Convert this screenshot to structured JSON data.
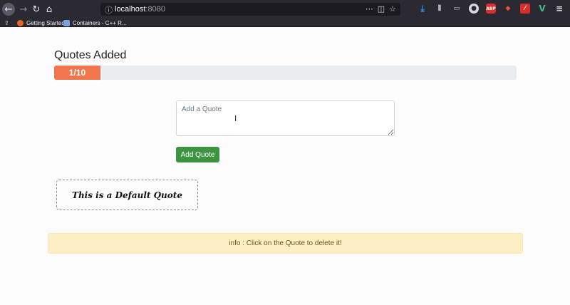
{
  "browser": {
    "url_host": "localhost",
    "url_port": ":8080",
    "bookmarks": [
      {
        "label": "Getting Started"
      },
      {
        "label": "Containers - C++ R..."
      }
    ],
    "extension_icons": [
      "download-icon",
      "library-icon",
      "reader-icon",
      "profile-icon",
      "adblock-icon",
      "shield-icon",
      "red-extension-icon",
      "vue-devtools-icon",
      "menu-icon"
    ]
  },
  "page": {
    "title": "Quotes Added",
    "progress": {
      "label": "1/10",
      "current": 1,
      "max": 10,
      "fill_color": "#f0764d"
    },
    "quote_input": {
      "placeholder": "Add a Quote",
      "value": ""
    },
    "add_button_label": "Add Quote",
    "quotes": [
      {
        "text": "This is a Default Quote"
      }
    ],
    "info_text": "info : Click on the Quote to delete it!"
  }
}
